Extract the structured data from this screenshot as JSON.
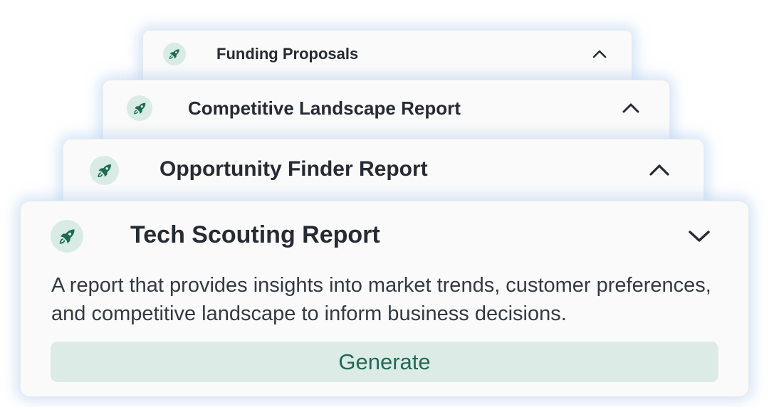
{
  "cards": [
    {
      "title": "Funding Proposals",
      "state": "collapsed",
      "toggle_icon": "chevron-up-icon"
    },
    {
      "title": "Competitive Landscape Report",
      "state": "collapsed",
      "toggle_icon": "chevron-up-icon"
    },
    {
      "title": "Opportunity Finder Report",
      "state": "collapsed",
      "toggle_icon": "chevron-up-icon"
    },
    {
      "title": "Tech Scouting Report",
      "state": "expanded",
      "toggle_icon": "chevron-down-icon",
      "description": "A  report that provides insights into market trends, customer preferences, and competitive landscape to inform business decisions.",
      "button_label": "Generate"
    }
  ],
  "icons": {
    "card_icon": "rocket-icon"
  },
  "colors": {
    "accent": "#1d6b55",
    "icon_bg": "#d9ebe5",
    "button_bg": "#dcebe6",
    "card_bg": "#fafafa",
    "title_text": "#262b33",
    "glow": "#b2ceee"
  }
}
